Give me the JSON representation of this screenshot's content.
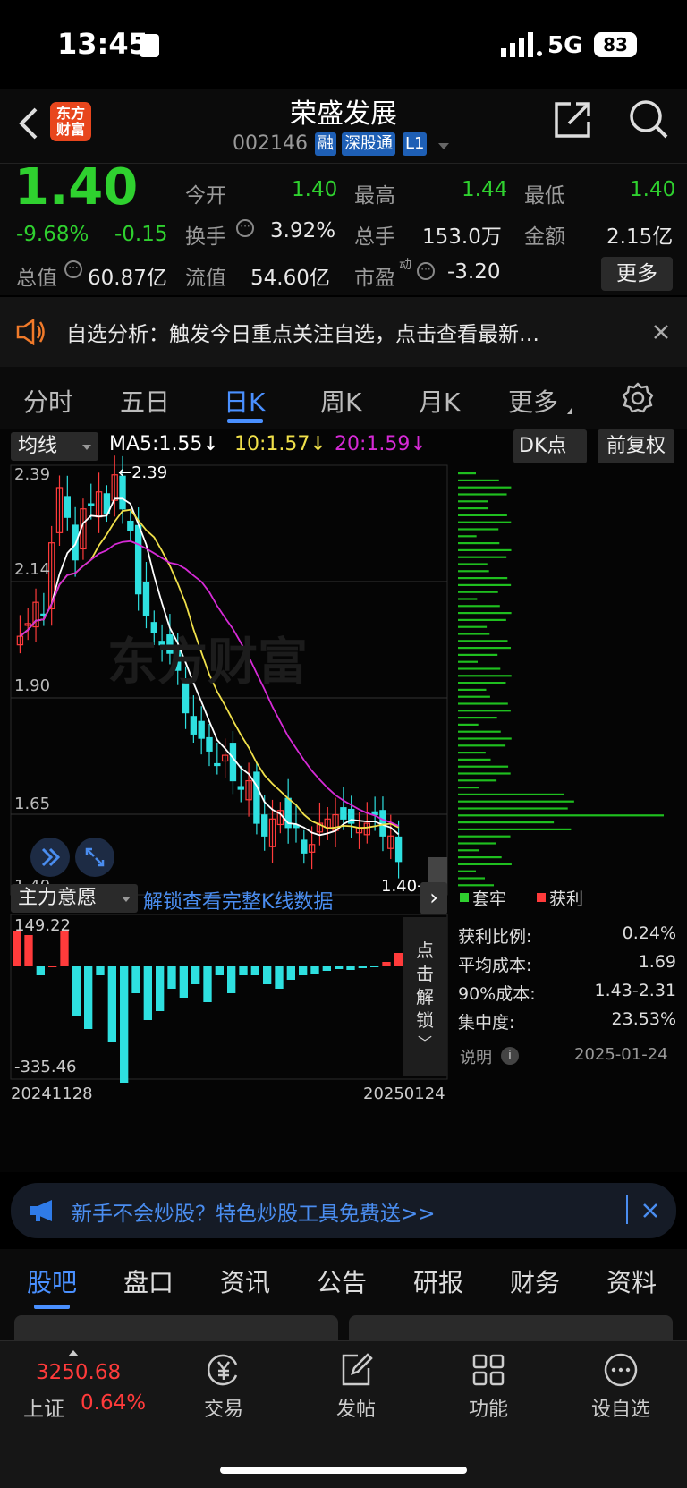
{
  "status_bar": {
    "time": "13:45",
    "network": "5G",
    "battery": "83"
  },
  "header": {
    "logo_text": "东方财富",
    "stock_name": "荣盛发展",
    "stock_code": "002146",
    "tags": [
      "融",
      "深股通",
      "L1"
    ]
  },
  "quote": {
    "price": "1.40",
    "change_pct": "-9.68%",
    "change": "-0.15",
    "cells": [
      {
        "label": "今开",
        "value": "1.40",
        "color": "#2fd12f"
      },
      {
        "label": "最高",
        "value": "1.44",
        "color": "#2fd12f"
      },
      {
        "label": "最低",
        "value": "1.40",
        "color": "#2fd12f"
      },
      {
        "label": "换手",
        "value": "3.92%",
        "color": "#e8e8e8"
      },
      {
        "label": "总手",
        "value": "153.0万",
        "color": "#e8e8e8"
      },
      {
        "label": "金额",
        "value": "2.15亿",
        "color": "#e8e8e8"
      },
      {
        "label": "总值",
        "value": "60.87亿",
        "color": "#e8e8e8"
      },
      {
        "label": "流值",
        "value": "54.60亿",
        "color": "#e8e8e8"
      },
      {
        "label": "市盈",
        "label_sup": "动",
        "value": "-3.20",
        "color": "#e8e8e8"
      }
    ],
    "more_button": "更多"
  },
  "notice": {
    "text": "自选分析：触发今日重点关注自选，点击查看最新…"
  },
  "chart_tabs": [
    "分时",
    "五日",
    "日K",
    "周K",
    "月K",
    "更多"
  ],
  "chart_tabs_active": 2,
  "kline": {
    "indicator_select": "均线",
    "ma5": "MA5:1.55↓",
    "ma10": "10:1.57↓",
    "ma20": "20:1.59↓",
    "dk_button": "DK点",
    "adjust_button": "前复权",
    "y_ticks": [
      "2.39",
      "2.14",
      "1.90",
      "1.65",
      "1.40"
    ],
    "max_label": "2.39",
    "min_label": "1.40",
    "watermark": "东方财富",
    "colors": {
      "up": "#ff3b3b",
      "down": "#2ee0e0",
      "ma5": "#ffffff",
      "ma10": "#f0e04a",
      "ma20": "#d62ad6"
    }
  },
  "volume": {
    "select": "主力意愿",
    "unlock_text": "解锁查看完整K线数据",
    "max_label": "149.22",
    "min_label": "-335.46",
    "date_start": "20241128",
    "date_end": "20250124",
    "unlock_side": [
      "点",
      "击",
      "解",
      "锁"
    ]
  },
  "chip": {
    "legend_trapped": "套牢",
    "legend_profit": "获利",
    "rows": [
      {
        "label": "获利比例:",
        "value": "0.24%"
      },
      {
        "label": "平均成本:",
        "value": "1.69"
      },
      {
        "label": "90%成本:",
        "value": "1.43-2.31"
      },
      {
        "label": "集中度:",
        "value": "23.53%"
      }
    ],
    "note_label": "说明",
    "date": "2025-01-24"
  },
  "banner": {
    "text": "新手不会炒股？特色炒股工具免费送>>"
  },
  "bottom_tabs": [
    "股吧",
    "盘口",
    "资讯",
    "公告",
    "研报",
    "财务",
    "资料"
  ],
  "bottom_tabs_active": 0,
  "bottom_nav": {
    "index_value": "3250.68",
    "index_name": "上证",
    "index_change": "0.64%",
    "items": [
      "交易",
      "发帖",
      "功能",
      "设自选"
    ]
  }
}
